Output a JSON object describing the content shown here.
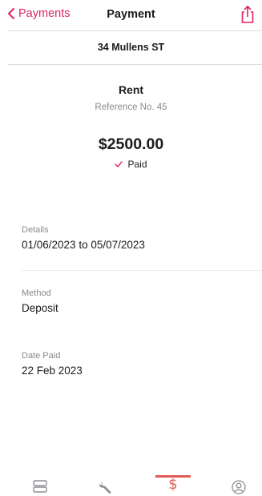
{
  "nav": {
    "back_label": "Payments",
    "title": "Payment"
  },
  "property": {
    "address": "34 Mullens ST"
  },
  "payment": {
    "type": "Rent",
    "reference": "Reference No. 45",
    "amount": "$2500.00",
    "status": "Paid"
  },
  "fields": [
    {
      "label": "Details",
      "value": "01/06/2023 to 05/07/2023"
    },
    {
      "label": "Method",
      "value": "Deposit"
    },
    {
      "label": "Date Paid",
      "value": "22 Feb 2023"
    }
  ],
  "tabs": [
    {
      "icon": "list-icon",
      "active": false
    },
    {
      "icon": "wrench-icon",
      "active": false
    },
    {
      "icon": "dollar-icon",
      "active": true,
      "glyph": "$"
    },
    {
      "icon": "profile-icon",
      "active": false
    }
  ],
  "colors": {
    "accent": "#e0245e",
    "active_tab": "#e35a55",
    "muted_text": "#8a8a8e",
    "divider": "#dedede"
  }
}
